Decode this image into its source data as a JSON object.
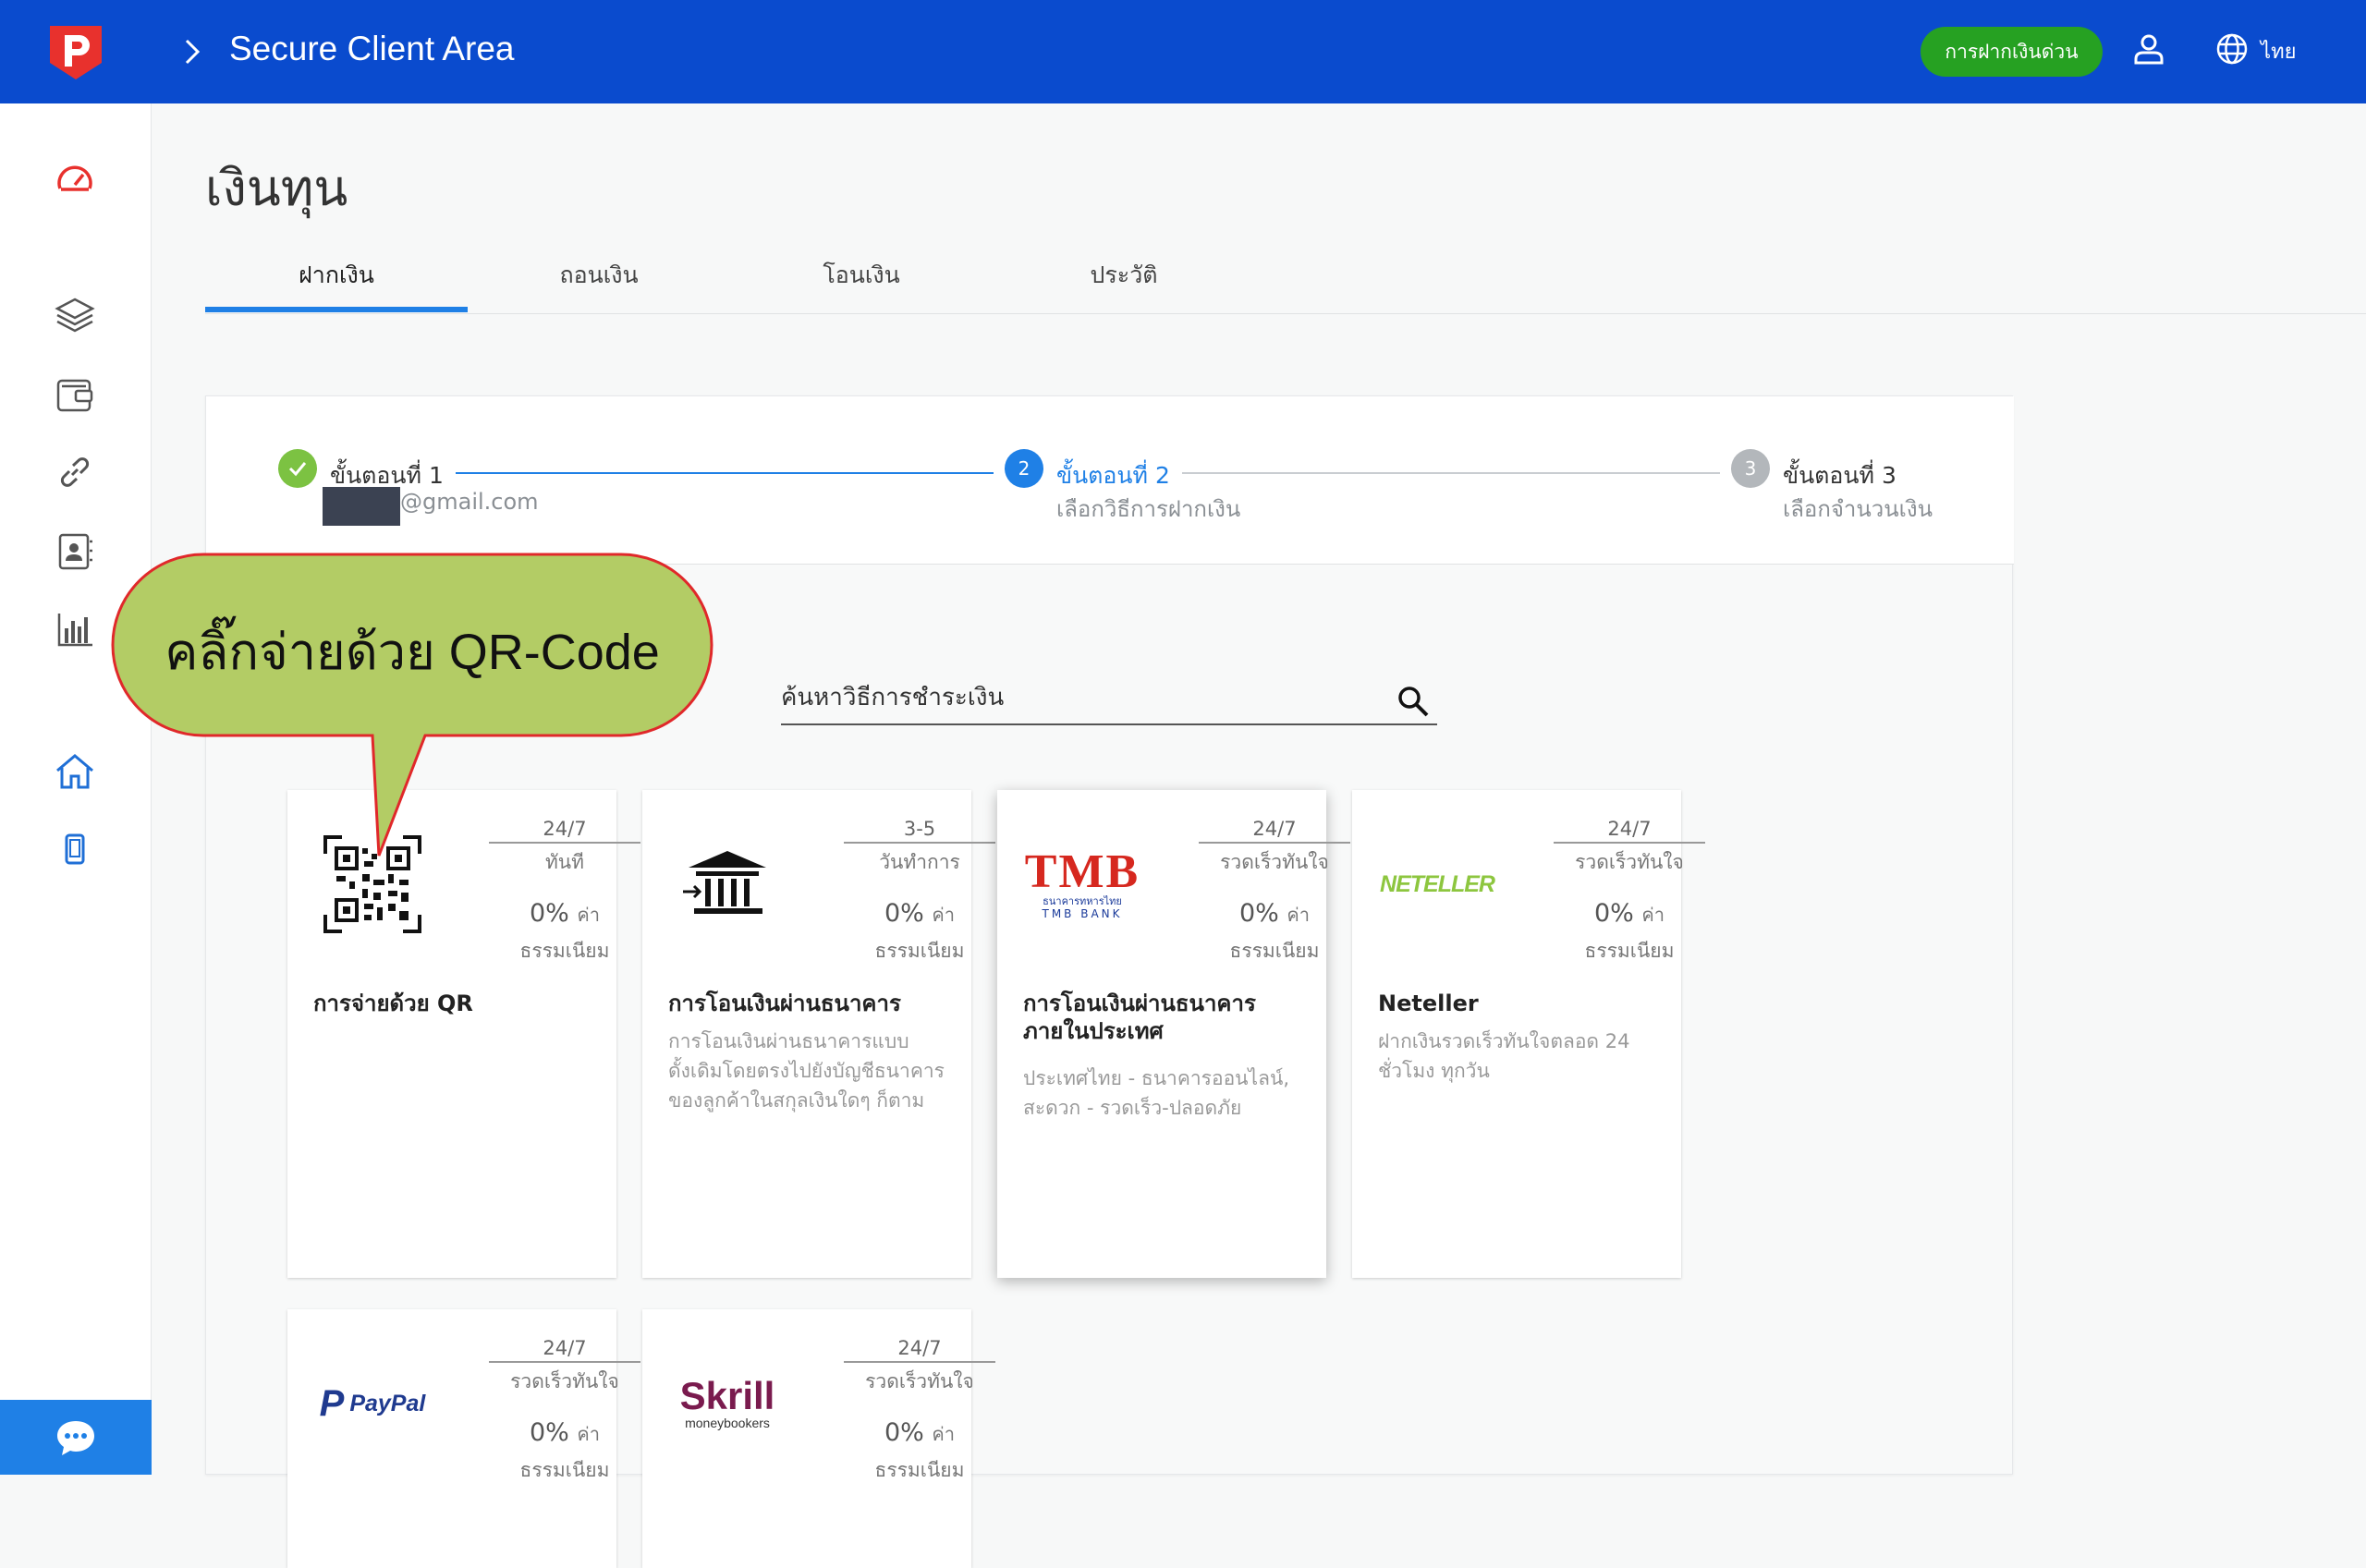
{
  "header": {
    "title": "Secure Client Area",
    "express_deposit": "การฝากเงินด่วน",
    "language": "ไทย"
  },
  "page": {
    "title": "เงินทุน"
  },
  "tabs": [
    {
      "label": "ฝากเงิน"
    },
    {
      "label": "ถอนเงิน"
    },
    {
      "label": "โอนเงิน"
    },
    {
      "label": "ประวัติ"
    }
  ],
  "stepper": {
    "step1": {
      "number": "1",
      "title": "ขั้นตอนที่ 1",
      "sub": "@gmail.com"
    },
    "step2": {
      "number": "2",
      "title": "ขั้นตอนที่ 2",
      "sub": "เลือกวิธีการฝากเงิน"
    },
    "step3": {
      "number": "3",
      "title": "ขั้นตอนที่ 3",
      "sub": "เลือกจำนวนเงิน"
    }
  },
  "search": {
    "placeholder": "ค้นหาวิธีการชำระเงิน"
  },
  "callout": {
    "text": "คลิ๊กจ่ายด้วย QR-Code"
  },
  "methods": [
    {
      "time": "24/7",
      "speed": "ทันที",
      "fee": "0%",
      "fee_word": "ค่า",
      "fee_label": "ธรรมเนียม",
      "name": "การจ่ายด้วย QR",
      "desc": ""
    },
    {
      "time": "3-5",
      "speed": "วันทำการ",
      "fee": "0%",
      "fee_word": "ค่า",
      "fee_label": "ธรรมเนียม",
      "name": "การโอนเงินผ่านธนาคาร",
      "desc": "การโอนเงินผ่านธนาคารแบบดั้งเดิมโดยตรงไปยังบัญชีธนาคารของลูกค้าในสกุลเงินใดๆ ก็ตาม"
    },
    {
      "time": "24/7",
      "speed": "รวดเร็วทันใจ",
      "fee": "0%",
      "fee_word": "ค่า",
      "fee_label": "ธรรมเนียม",
      "name": "การโอนเงินผ่านธนาคารภายในประเทศ",
      "desc": "ประเทศไทย - ธนาคารออนไลน์, สะดวก - รวดเร็ว-ปลอดภัย"
    },
    {
      "time": "24/7",
      "speed": "รวดเร็วทันใจ",
      "fee": "0%",
      "fee_word": "ค่า",
      "fee_label": "ธรรมเนียม",
      "name": "Neteller",
      "desc": "ฝากเงินรวดเร็วทันใจตลอด 24 ชั่วโมง ทุกวัน"
    },
    {
      "time": "24/7",
      "speed": "รวดเร็วทันใจ",
      "fee": "0%",
      "fee_word": "ค่า",
      "fee_label": "ธรรมเนียม",
      "name": "",
      "desc": ""
    },
    {
      "time": "24/7",
      "speed": "รวดเร็วทันใจ",
      "fee": "0%",
      "fee_word": "ค่า",
      "fee_label": "ธรรมเนียม",
      "name": "",
      "desc": ""
    }
  ],
  "logos": {
    "tmb": "TMB",
    "tmb_thai": "ธนาคารทหารไทย",
    "tmb_bank": "TMB BANK",
    "neteller": "NETELLER",
    "paypal": "PayPal",
    "skrill": "Skrill",
    "skrill_sub": "moneybookers"
  },
  "colors": {
    "header_bg": "#0a4bce",
    "accent": "#1f80e6",
    "express_button": "#26a122",
    "step_done": "#7cc242",
    "callout_fill": "#b3cc65",
    "callout_border": "#e0282a"
  }
}
